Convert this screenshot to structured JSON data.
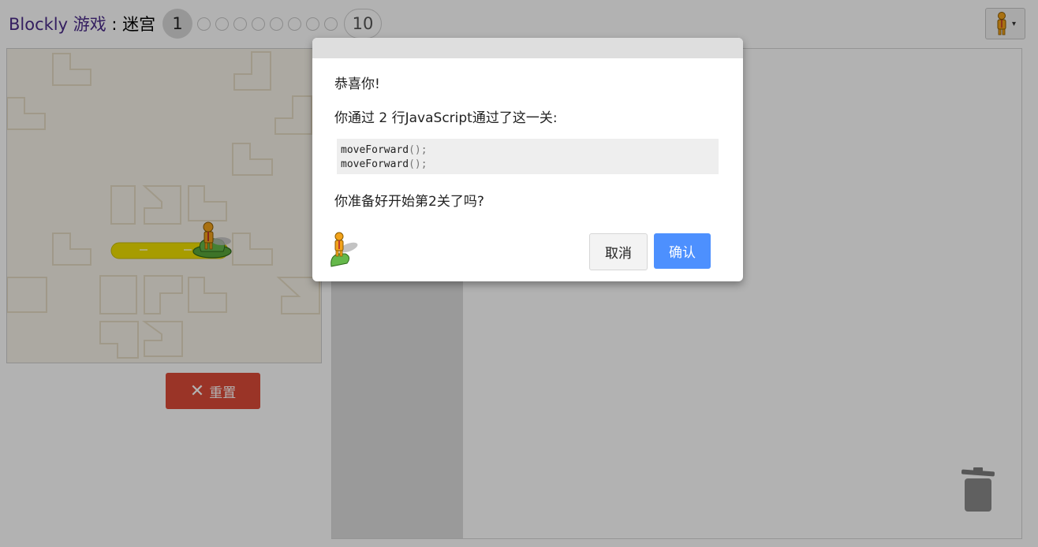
{
  "header": {
    "app_name": "Blockly 游戏",
    "separator": " : ",
    "game_name": "迷宫",
    "current_level": "1",
    "last_level": "10",
    "level_dot_count": 8,
    "pegman_icon": "pegman-icon",
    "dropdown_icon": "chevron-down-icon",
    "dropdown_glyph": "▾"
  },
  "maze": {
    "path_color": "#f0e000",
    "wall_color": "#f7f3e8"
  },
  "controls": {
    "reset_icon": "close-icon",
    "reset_glyph": "✕",
    "reset_label": "重置"
  },
  "workspace": {
    "trash_icon": "trash-icon"
  },
  "dialog": {
    "congrats": "恭喜你!",
    "summary": "你通过 2 行JavaScript通过了这一关:",
    "code_lines": [
      {
        "name": "moveForward",
        "paren": "();"
      },
      {
        "name": "moveForward",
        "paren": "();"
      }
    ],
    "next_prompt": "你准备好开始第2关了吗?",
    "cancel_label": "取消",
    "ok_label": "确认"
  },
  "colors": {
    "accent": "#4d90fe",
    "reset": "#dd4b39",
    "title": "#4b2c8a"
  }
}
